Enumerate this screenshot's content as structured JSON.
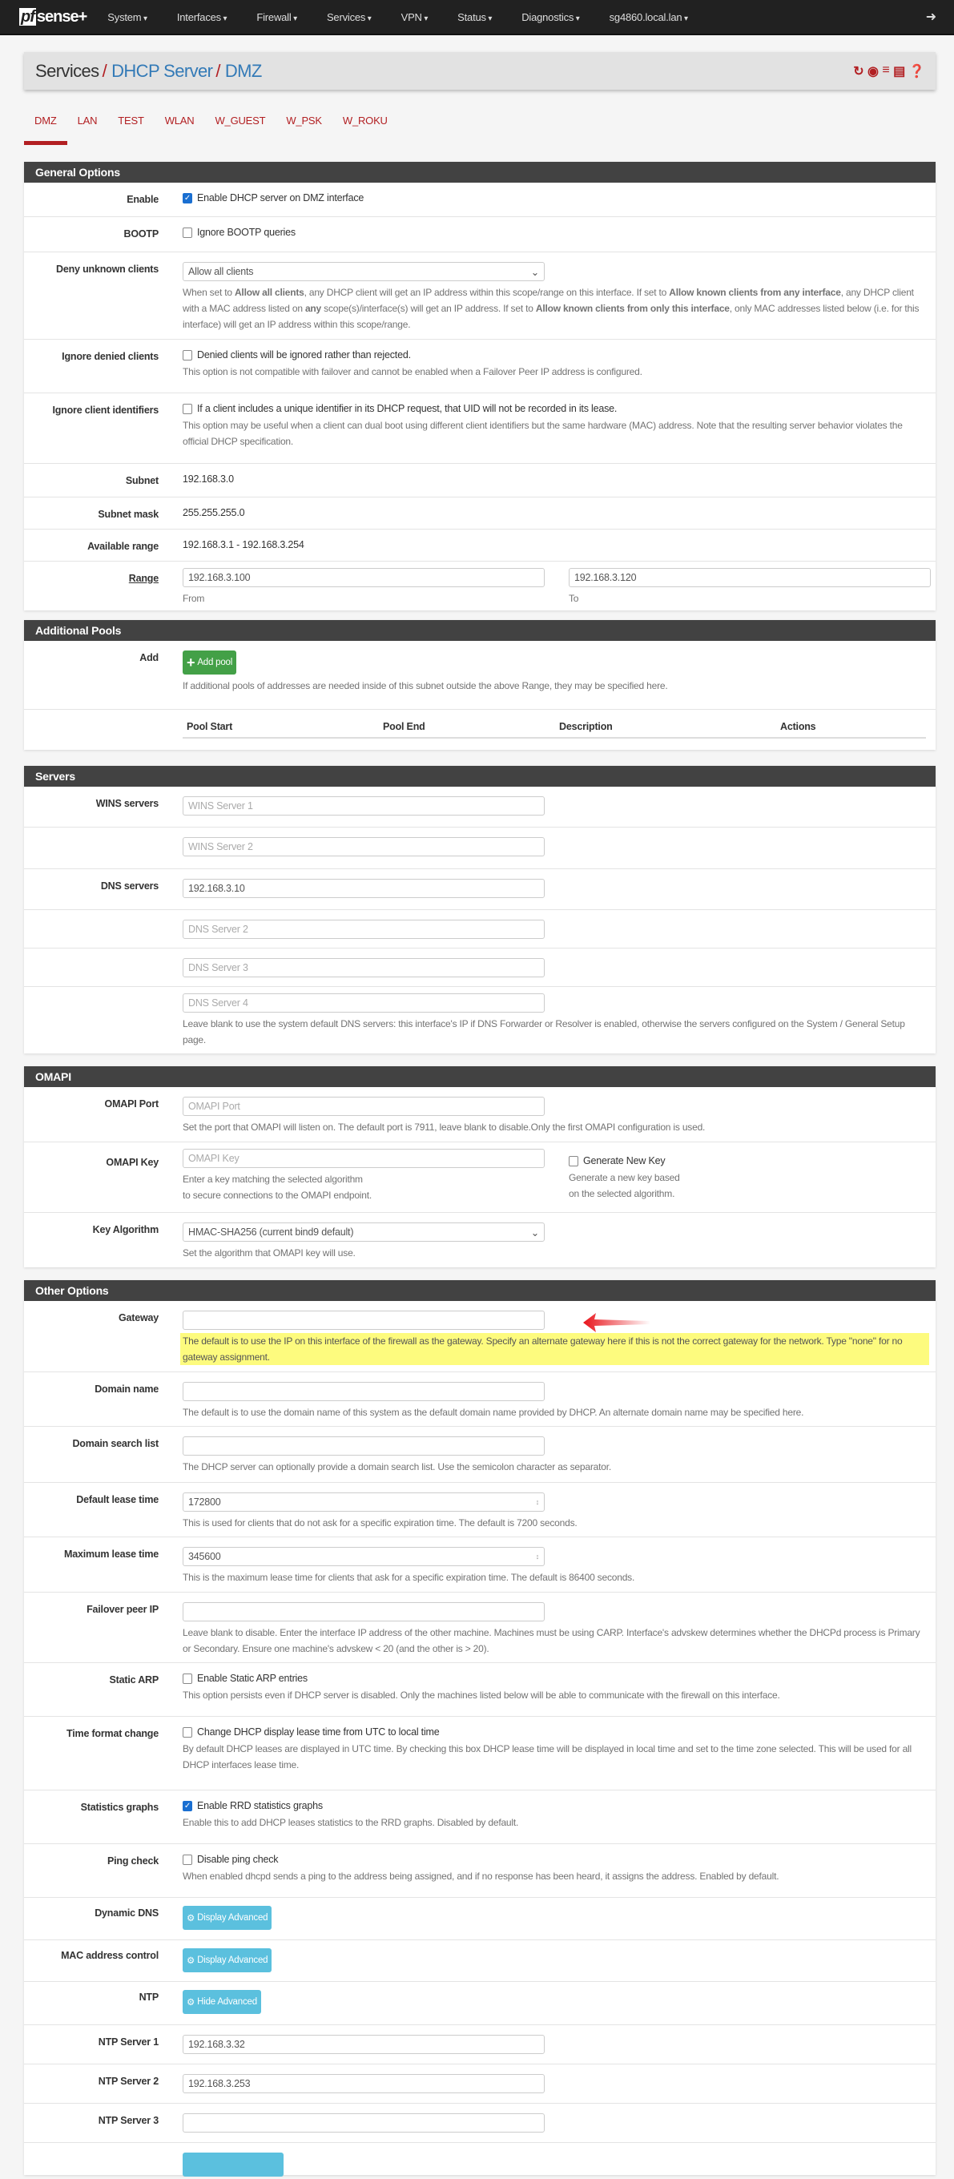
{
  "nav": {
    "logo": "sense",
    "logo_pf": "pf",
    "logo_plus": "+",
    "items": [
      "System",
      "Interfaces",
      "Firewall",
      "Services",
      "VPN",
      "Status",
      "Diagnostics",
      "sg4860.local.lan"
    ],
    "logout_icon": "sign-out-icon"
  },
  "breadcrumb": {
    "root": "Services",
    "sep": "/",
    "level2": "DHCP Server",
    "level3": "DMZ",
    "icons": [
      "restart-service-icon",
      "stop-service-icon",
      "status-graph-icon",
      "log-icon",
      "help-icon"
    ]
  },
  "tabs": [
    "DMZ",
    "LAN",
    "TEST",
    "WLAN",
    "W_GUEST",
    "W_PSK",
    "W_ROKU"
  ],
  "general": {
    "title": "General Options",
    "enable": {
      "label": "Enable",
      "text": "Enable DHCP server on DMZ interface",
      "checked": true
    },
    "bootp": {
      "label": "BOOTP",
      "text": "Ignore BOOTP queries",
      "checked": false
    },
    "deny": {
      "label": "Deny unknown clients",
      "value": "Allow all clients",
      "h1": "When set to ",
      "b1": "Allow all clients",
      "h2": ", any DHCP client will get an IP address within this scope/range on this interface. If set to ",
      "b2": "Allow known clients from any interface",
      "h3": ", any DHCP client with a MAC address listed on ",
      "b3": "any",
      "h4": " scope(s)/interface(s) will get an IP address. If set to ",
      "b4": "Allow known clients from only this interface",
      "h5": ", only MAC addresses listed below (i.e. for this interface) will get an IP address within this scope/range."
    },
    "ignore_denied": {
      "label": "Ignore denied clients",
      "text": "Denied clients will be ignored rather than rejected.",
      "help": "This option is not compatible with failover and cannot be enabled when a Failover Peer IP address is configured.",
      "checked": false
    },
    "ignore_ids": {
      "label": "Ignore client identifiers",
      "text": "If a client includes a unique identifier in its DHCP request, that UID will not be recorded in its lease.",
      "help": "This option may be useful when a client can dual boot using different client identifiers but the same hardware (MAC) address. Note that the resulting server behavior violates the official DHCP specification.",
      "checked": false
    },
    "subnet": {
      "label": "Subnet",
      "value": "192.168.3.0"
    },
    "mask": {
      "label": "Subnet mask",
      "value": "255.255.255.0"
    },
    "avail": {
      "label": "Available range",
      "value": "192.168.3.1 - 192.168.3.254"
    },
    "range": {
      "label": "Range",
      "from": "192.168.3.100",
      "from_label": "From",
      "to": "192.168.3.120",
      "to_label": "To"
    }
  },
  "pools": {
    "title": "Additional Pools",
    "add_label": "Add",
    "button": "Add pool",
    "help": "If additional pools of addresses are needed inside of this subnet outside the above Range, they may be specified here.",
    "columns": [
      "Pool Start",
      "Pool End",
      "Description",
      "Actions"
    ]
  },
  "servers": {
    "title": "Servers",
    "wins_label": "WINS servers",
    "wins": [
      "WINS Server 1",
      "WINS Server 2"
    ],
    "dns_label": "DNS servers",
    "dns1": "192.168.3.10",
    "dns_ph": [
      "DNS Server 2",
      "DNS Server 3",
      "DNS Server 4"
    ],
    "dns_help": "Leave blank to use the system default DNS servers: this interface's IP if DNS Forwarder or Resolver is enabled, otherwise the servers configured on the System / General Setup page."
  },
  "omapi": {
    "title": "OMAPI",
    "port_label": "OMAPI Port",
    "port_ph": "OMAPI Port",
    "port_help": "Set the port that OMAPI will listen on. The default port is 7911, leave blank to disable.Only the first OMAPI configuration is used.",
    "key_label": "OMAPI Key",
    "key_ph": "OMAPI Key",
    "key_help1": "Enter a key matching the selected algorithm",
    "key_help2": "to secure connections to the OMAPI endpoint.",
    "gen_label": "Generate New Key",
    "gen_help1": "Generate a new key based",
    "gen_help2": "on the selected algorithm.",
    "algo_label": "Key Algorithm",
    "algo_value": "HMAC-SHA256 (current bind9 default)",
    "algo_help": "Set the algorithm that OMAPI key will use."
  },
  "other": {
    "title": "Other Options",
    "gateway": {
      "label": "Gateway",
      "value": "",
      "help": "The default is to use the IP on this interface of the firewall as the gateway. Specify an alternate gateway here if this is not the correct gateway for the network. Type \"none\" for no gateway assignment.",
      "highlight": "#fdfb7e",
      "arrow_color": "#e8141b"
    },
    "domain": {
      "label": "Domain name",
      "value": "",
      "help": "The default is to use the domain name of this system as the default domain name provided by DHCP. An alternate domain name may be specified here."
    },
    "search": {
      "label": "Domain search list",
      "value": "",
      "help": "The DHCP server can optionally provide a domain search list. Use the semicolon character as separator."
    },
    "deflease": {
      "label": "Default lease time",
      "value": "172800",
      "help": "This is used for clients that do not ask for a specific expiration time. The default is 7200 seconds."
    },
    "maxlease": {
      "label": "Maximum lease time",
      "value": "345600",
      "help": "This is the maximum lease time for clients that ask for a specific expiration time. The default is 86400 seconds."
    },
    "failover": {
      "label": "Failover peer IP",
      "value": "",
      "help": "Leave blank to disable. Enter the interface IP address of the other machine. Machines must be using CARP. Interface's advskew determines whether the DHCPd process is Primary or Secondary. Ensure one machine's advskew < 20 (and the other is > 20)."
    },
    "staticarp": {
      "label": "Static ARP",
      "text": "Enable Static ARP entries",
      "help": "This option persists even if DHCP server is disabled. Only the machines listed below will be able to communicate with the firewall on this interface.",
      "checked": false
    },
    "timefmt": {
      "label": "Time format change",
      "text": "Change DHCP display lease time from UTC to local time",
      "help": "By default DHCP leases are displayed in UTC time. By checking this box DHCP lease time will be displayed in local time and set to the time zone selected. This will be used for all DHCP interfaces lease time.",
      "checked": false
    },
    "stats": {
      "label": "Statistics graphs",
      "text": "Enable RRD statistics graphs",
      "help": "Enable this to add DHCP leases statistics to the RRD graphs. Disabled by default.",
      "checked": true
    },
    "ping": {
      "label": "Ping check",
      "text": "Disable ping check",
      "help": "When enabled dhcpd sends a ping to the address being assigned, and if no response has been heard, it assigns the address. Enabled by default.",
      "checked": false
    },
    "ddns": {
      "label": "Dynamic DNS",
      "button": "Display Advanced"
    },
    "mac": {
      "label": "MAC address control",
      "button": "Display Advanced"
    },
    "ntp": {
      "label": "NTP",
      "button": "Hide Advanced"
    },
    "ntp1": {
      "label": "NTP Server 1",
      "value": "192.168.3.32"
    },
    "ntp2": {
      "label": "NTP Server 2",
      "value": "192.168.3.253"
    },
    "ntp3": {
      "label": "NTP Server 3",
      "value": ""
    }
  }
}
